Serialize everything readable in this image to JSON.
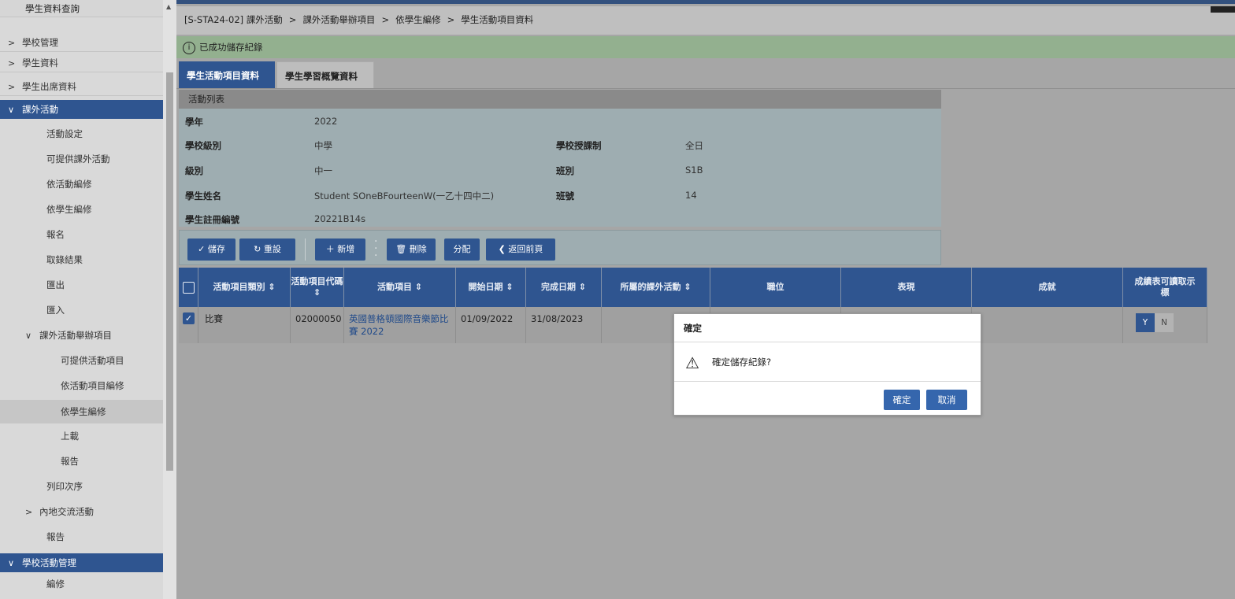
{
  "sidebar": {
    "top_item": "學生資料查詢",
    "sections": [
      {
        "label": "學校管理"
      },
      {
        "label": "學生資料"
      },
      {
        "label": "學生出席資料"
      }
    ],
    "active_section": "課外活動",
    "items": [
      "活動設定",
      "可提供課外活動",
      "依活動編修",
      "依學生編修",
      "報名",
      "取錄結果",
      "匯出",
      "匯入"
    ],
    "group": "課外活動舉辦項目",
    "group_items": [
      "可提供活動項目",
      "依活動項目編修",
      "依學生編修",
      "上載",
      "報告"
    ],
    "after_items": [
      "列印次序"
    ],
    "group2": "內地交流活動",
    "after_items2": [
      "報告"
    ],
    "section2": "學校活動管理",
    "section2_items": [
      "編修"
    ]
  },
  "breadcrumb": [
    "[S-STA24-02] 課外活動",
    "課外活動舉辦項目",
    "依學生編修",
    "學生活動項目資料"
  ],
  "message": "已成功儲存紀錄",
  "tabs": [
    "學生活動項目資料",
    "學生學習概覽資料"
  ],
  "panel": {
    "title": "活動列表",
    "fields": {
      "year_label": "學年",
      "year": "2022",
      "level_label": "學校級別",
      "level": "中學",
      "system_label": "學校授課制",
      "system": "全日",
      "grade_label": "級別",
      "grade": "中一",
      "class_label": "班別",
      "class": "S1B",
      "name_label": "學生姓名",
      "name": "Student SOneBFourteenW(一乙十四中二)",
      "number_label": "班號",
      "number": "14",
      "reg_label": "學生註冊編號",
      "reg": "20221B14s"
    }
  },
  "toolbar": {
    "save": "儲存",
    "reset": "重設",
    "add": "新增",
    "delete": "刪除",
    "assign": "分配",
    "back": "返回前頁"
  },
  "grid": {
    "headers": [
      "活動項目類別 ⇕",
      "活動項目代碼 ⇕",
      "活動項目 ⇕",
      "開始日期 ⇕",
      "完成日期 ⇕",
      "所屬的課外活動 ⇕",
      "職位",
      "表現",
      "成就",
      "成績表可讀取示標"
    ],
    "rows": [
      {
        "category": "比賽",
        "code": "02000050",
        "item": "英國普格頓國際音樂節比賽 2022",
        "start": "01/09/2022",
        "end": "31/08/2023",
        "y": "Y",
        "n": "N"
      }
    ]
  },
  "dialog": {
    "title": "確定",
    "message": "確定儲存紀錄?",
    "confirm": "確定",
    "cancel": "取消"
  },
  "colors": {
    "accent": "#2f5590",
    "success_bar": "#93b08f"
  }
}
